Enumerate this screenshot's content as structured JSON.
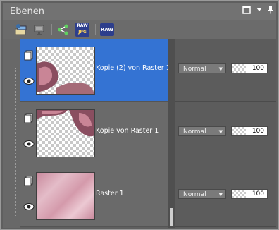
{
  "panel": {
    "title": "Ebenen",
    "controls": [
      "maximize-icon",
      "dropdown-icon",
      "pin-icon"
    ]
  },
  "toolbar": {
    "icons": [
      "layer-properties-icon",
      "monitor-icon",
      "share-icon",
      "raw-jpg-icon",
      "raw-icon"
    ],
    "raw_jpg_label_top": "RAW",
    "raw_jpg_label_bottom": "JPG",
    "raw_label": "RAW"
  },
  "layers": [
    {
      "name": "Kopie (2) von Raster 1",
      "selected": true,
      "blend_mode": "Normal",
      "opacity": "100",
      "visible": true
    },
    {
      "name": "Kopie von Raster 1",
      "selected": false,
      "blend_mode": "Normal",
      "opacity": "100",
      "visible": true
    },
    {
      "name": "Raster 1",
      "selected": false,
      "blend_mode": "Normal",
      "opacity": "100",
      "visible": true
    }
  ],
  "colors": {
    "selection": "#3473d3",
    "panel_bg": "#5f5f5f",
    "thumb_pink": "#d9a9b8"
  }
}
